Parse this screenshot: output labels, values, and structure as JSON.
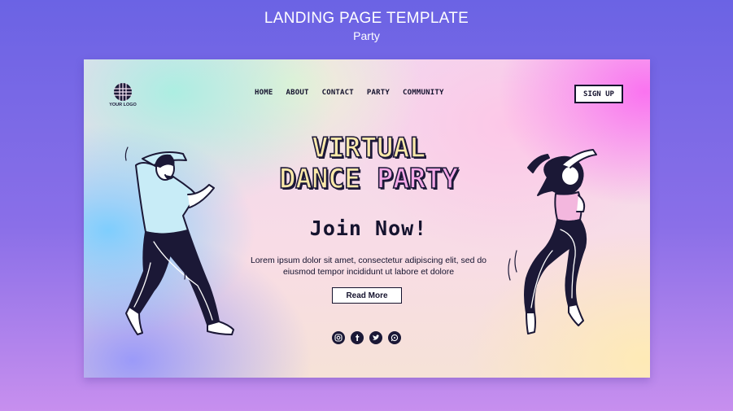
{
  "header": {
    "title": "LANDING PAGE TEMPLATE",
    "subtitle": "Party"
  },
  "landing": {
    "logo_text": "YOUR LOGO",
    "nav": [
      "HOME",
      "ABOUT",
      "CONTACT",
      "PARTY",
      "COMMUNITY"
    ],
    "signup_label": "SIGN UP",
    "headline_line1": "VIRTUAL",
    "headline_line2_a": "DANCE ",
    "headline_line2_b": "PARTY",
    "cta_heading": "Join Now!",
    "body_text": "Lorem ipsum dolor sit amet, consectetur adipiscing elit, sed do eiusmod tempor incididunt ut labore et dolore",
    "read_more_label": "Read More",
    "socials": [
      "instagram-icon",
      "facebook-icon",
      "twitter-icon",
      "whatsapp-icon"
    ]
  },
  "colors": {
    "page_bg_top": "#6b63e4",
    "page_bg_bottom": "#c78fee",
    "ink": "#15132e",
    "headline_yellow": "#fbe9a9",
    "headline_pink": "#f5a9e8"
  }
}
